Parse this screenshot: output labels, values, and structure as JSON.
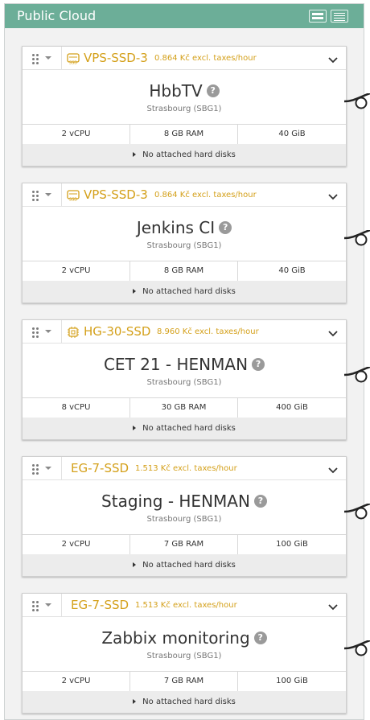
{
  "panel": {
    "title": "Public Cloud",
    "accent": "#6cae98",
    "buttons": [
      {
        "name": "view-list-large-button",
        "icon": "list-large-icon"
      },
      {
        "name": "view-list-compact-button",
        "icon": "list-compact-icon"
      }
    ]
  },
  "colors": {
    "flavor": "#d4a01a",
    "help": "#9a9a9a"
  },
  "servers": [
    {
      "flavor": "VPS-SSD-3",
      "flavor_icon": "ssd-icon",
      "price": "0.864 Kč excl. taxes/hour",
      "name": "HbbTV",
      "location": "Strasbourg (SBG1)",
      "cpu": "2 vCPU",
      "ram": "8 GB RAM",
      "disk": "40 GiB",
      "disks_label": "No attached hard disks"
    },
    {
      "flavor": "VPS-SSD-3",
      "flavor_icon": "ssd-icon",
      "price": "0.864 Kč excl. taxes/hour",
      "name": "Jenkins CI",
      "location": "Strasbourg (SBG1)",
      "cpu": "2 vCPU",
      "ram": "8 GB RAM",
      "disk": "40 GiB",
      "disks_label": "No attached hard disks"
    },
    {
      "flavor": "HG-30-SSD",
      "flavor_icon": "chip-icon",
      "price": "8.960 Kč excl. taxes/hour",
      "name": "CET 21 - HENMAN",
      "location": "Strasbourg (SBG1)",
      "cpu": "8 vCPU",
      "ram": "30 GB RAM",
      "disk": "400 GiB",
      "disks_label": "No attached hard disks"
    },
    {
      "flavor": "EG-7-SSD",
      "flavor_icon": "",
      "price": "1.513 Kč excl. taxes/hour",
      "name": "Staging - HENMAN",
      "location": "Strasbourg (SBG1)",
      "cpu": "2 vCPU",
      "ram": "7 GB RAM",
      "disk": "100 GiB",
      "disks_label": "No attached hard disks"
    },
    {
      "flavor": "EG-7-SSD",
      "flavor_icon": "",
      "price": "1.513 Kč excl. taxes/hour",
      "name": "Zabbix monitoring",
      "location": "Strasbourg (SBG1)",
      "cpu": "2 vCPU",
      "ram": "7 GB RAM",
      "disk": "100 GiB",
      "disks_label": "No attached hard disks"
    }
  ]
}
